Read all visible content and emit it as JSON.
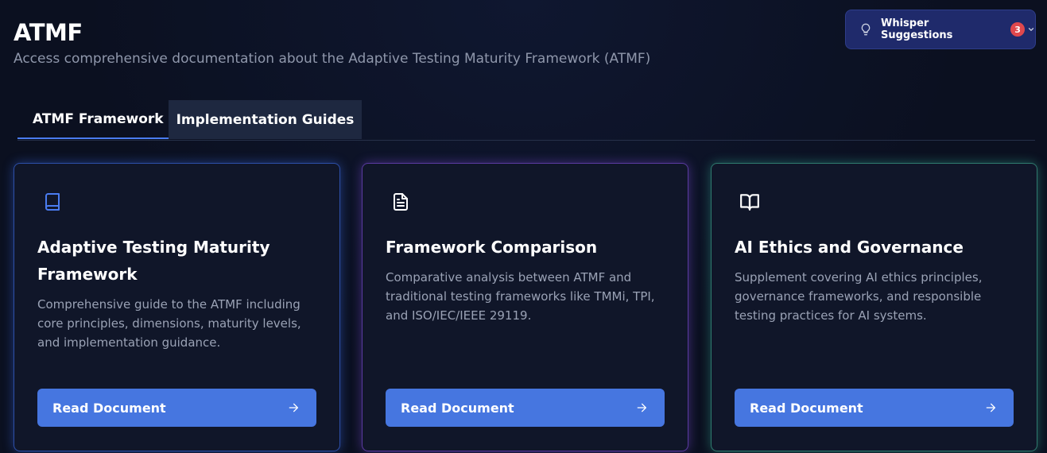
{
  "header": {
    "title": "ATMF",
    "subtitle": "Access comprehensive documentation about the Adaptive Testing Maturity Framework (ATMF)"
  },
  "whisper": {
    "label": "Whisper Suggestions",
    "count": "3",
    "icon": "lightbulb-icon"
  },
  "tabs": [
    {
      "label": "ATMF Framework",
      "active": true
    },
    {
      "label": "Implementation Guides",
      "active": false
    }
  ],
  "cards": [
    {
      "title": "Adaptive Testing Maturity Framework",
      "description": "Comprehensive guide to the ATMF including core principles, dimensions, maturity levels, and implementation guidance.",
      "button": "Read Document",
      "icon": "book-icon",
      "accent": "#4a7cf0"
    },
    {
      "title": "Framework Comparison",
      "description": "Comparative analysis between ATMF and traditional testing frameworks like TMMi, TPI, and ISO/IEC/IEEE 29119.",
      "button": "Read Document",
      "icon": "file-text-icon",
      "accent": "#8a5cf0"
    },
    {
      "title": "AI Ethics and Governance",
      "description": "Supplement covering AI ethics principles, governance frameworks, and responsible testing practices for AI systems.",
      "button": "Read Document",
      "icon": "book-open-icon",
      "accent": "#3fc8aa"
    }
  ],
  "colors": {
    "background": "#0b1020",
    "card": "#101629",
    "primary_button": "#4676e0",
    "badge": "#e0484d"
  }
}
